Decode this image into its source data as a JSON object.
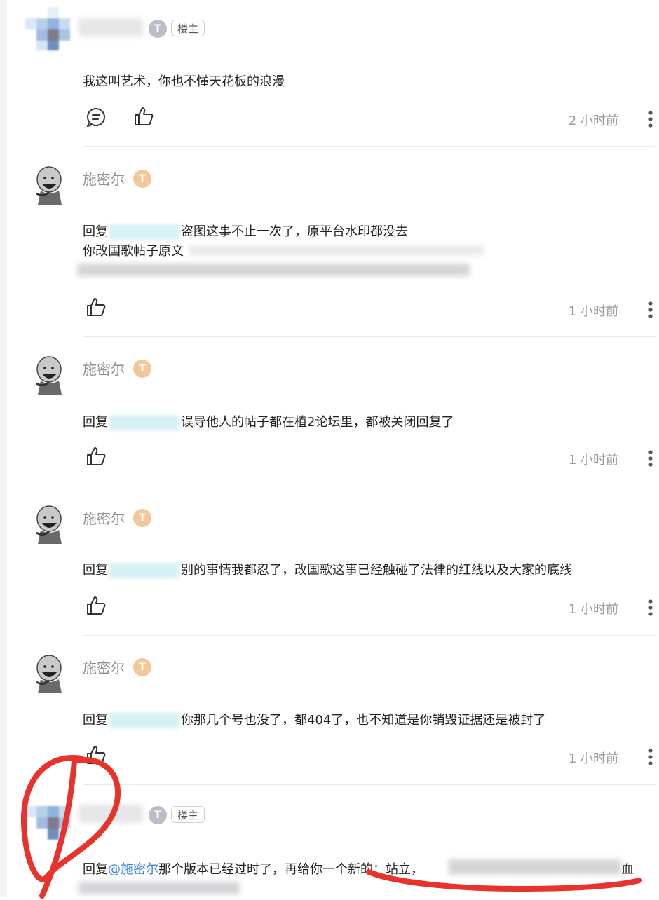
{
  "comments": [
    {
      "id": "c0",
      "author": "",
      "is_op": true,
      "op_tag": "楼主",
      "level": "T",
      "text": "我这叫艺术，你也不懂天花板的浪漫",
      "time": "2 小时前",
      "show_reply_icon": true
    },
    {
      "id": "c1",
      "author": "施密尔",
      "level": "T",
      "reply_prefix": "回复",
      "text_line1": "盗图这事不止一次了，原平台水印都没去",
      "text_line2": "你改国歌帖子原文",
      "time": "1 小时前"
    },
    {
      "id": "c2",
      "author": "施密尔",
      "level": "T",
      "reply_prefix": "回复",
      "text": "误导他人的帖子都在植2论坛里，都被关闭回复了",
      "time": "1 小时前"
    },
    {
      "id": "c3",
      "author": "施密尔",
      "level": "T",
      "reply_prefix": "回复",
      "text": "别的事情我都忍了，改国歌这事已经触碰了法律的红线以及大家的底线",
      "time": "1 小时前"
    },
    {
      "id": "c4",
      "author": "施密尔",
      "level": "T",
      "reply_prefix": "回复",
      "text": "你那几个号也没了，都404了，也不知道是你销毁证据还是被封了",
      "time": "1 小时前"
    },
    {
      "id": "c5",
      "author": "",
      "is_op": true,
      "op_tag": "楼主",
      "level": "T",
      "reply_prefix": "回复",
      "mention": "@施密尔",
      "text": "那个版本已经过时了，再给你一个新的：站立，",
      "text_end": "血"
    }
  ],
  "colors": {
    "annotation_red": "#e8322b",
    "muted_text": "#999999",
    "level_gold": "#f2c89a",
    "mention_blue": "#3b83e6"
  },
  "icons": [
    "reply-icon",
    "like-icon",
    "more-icon",
    "level-icon",
    "avatar-icon"
  ]
}
